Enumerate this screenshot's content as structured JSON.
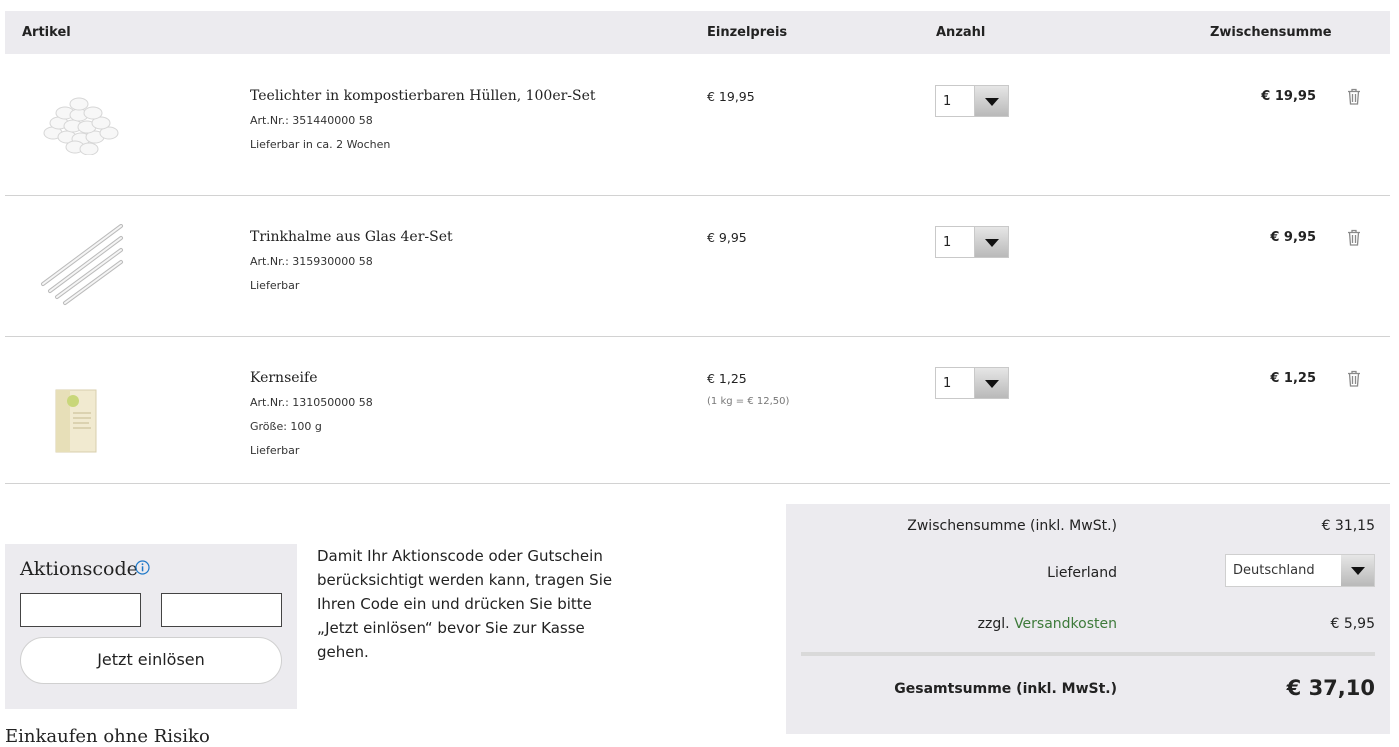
{
  "table": {
    "headers": {
      "artikel": "Artikel",
      "einzelpreis": "Einzelpreis",
      "anzahl": "Anzahl",
      "zwischensumme": "Zwischensumme"
    }
  },
  "items": [
    {
      "name": "Teelichter in kompostierbaren Hüllen, 100er-Set",
      "artnr": "Art.Nr.: 351440000 58",
      "meta": [
        "Lieferbar in ca. 2 Wochen"
      ],
      "price": "€ 19,95",
      "unit_price": "",
      "qty": "1",
      "subtotal": "€ 19,95"
    },
    {
      "name": "Trinkhalme aus Glas 4er-Set",
      "artnr": "Art.Nr.: 315930000 58",
      "meta": [
        "Lieferbar"
      ],
      "price": "€ 9,95",
      "unit_price": "",
      "qty": "1",
      "subtotal": "€ 9,95"
    },
    {
      "name": "Kernseife",
      "artnr": "Art.Nr.: 131050000 58",
      "meta": [
        "Größe: 100 g",
        "Lieferbar"
      ],
      "price": "€ 1,25",
      "unit_price": "(1 kg = € 12,50)",
      "qty": "1",
      "subtotal": "€ 1,25"
    }
  ],
  "promo": {
    "title": "Aktionscode",
    "button": "Jetzt einlösen",
    "text": "Damit Ihr Aktionscode oder Gutschein berücksichtigt werden kann, tragen Sie Ihren Code ein und drücken Sie bitte „Jetzt einlösen“ bevor Sie zur Kasse gehen."
  },
  "summary": {
    "subtotal_label": "Zwischensumme (inkl. MwSt.)",
    "subtotal_value": "€ 31,15",
    "country_label": "Lieferland",
    "country_value": "Deutschland",
    "shipping_prefix": "zzgl.",
    "shipping_link": "Versandkosten",
    "shipping_value": "€ 5,95",
    "total_label": "Gesamtsumme (inkl. MwSt.)",
    "total_value": "€ 37,10"
  },
  "footer": {
    "heading": "Einkaufen ohne Risiko"
  },
  "colors": {
    "panel_bg": "#ecebef",
    "link": "#3d7a3a",
    "info_icon": "#1e78c8"
  }
}
